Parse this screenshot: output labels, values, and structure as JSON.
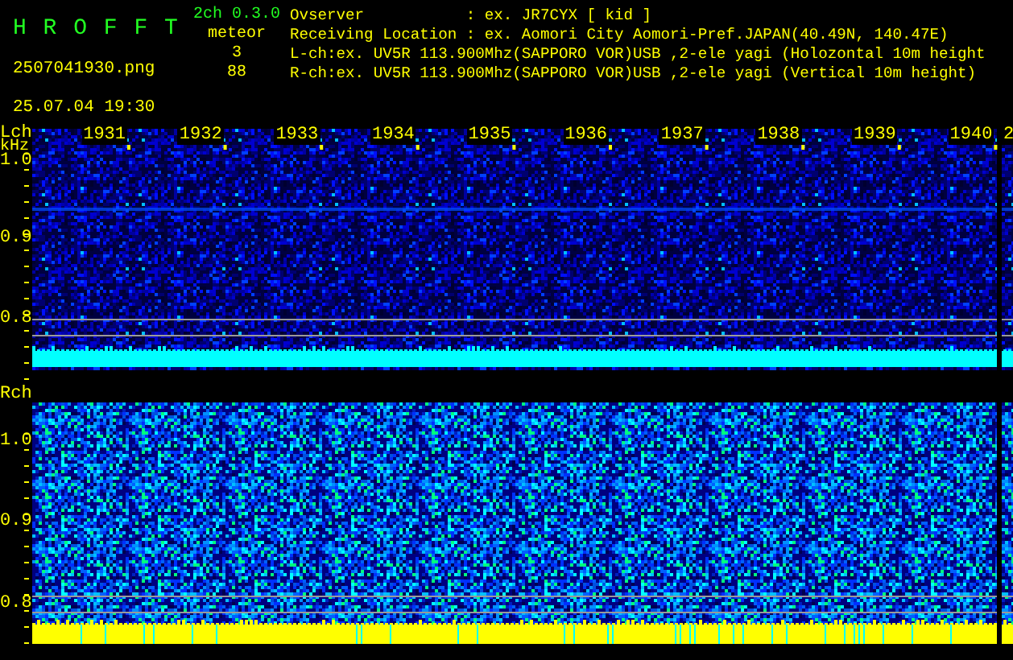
{
  "header": {
    "app_title": "H R O F F T",
    "version": "2ch 0.3.0",
    "file_name": "2507041930.png",
    "timestamp": "25.07.04 19:30",
    "meteor_label": "meteor",
    "meteor_counts": [
      "3",
      "88"
    ],
    "info_lines": [
      "Ovserver           : ex. JR7CYX [ kid ]",
      "Receiving Location : ex. Aomori City Aomori-Pref.JAPAN(40.49N, 140.47E)",
      "L-ch:ex. UV5R 113.900Mhz(SAPPORO VOR)USB ,2-ele yagi (Holozontal 10m height",
      "R-ch:ex. UV5R 113.900Mhz(SAPPORO VOR)USB ,2-ele yagi (Vertical 10m height)"
    ]
  },
  "time_axis": [
    "1931",
    "1932",
    "1933",
    "1934",
    "1935",
    "1936",
    "1937",
    "1938",
    "1939",
    "1940",
    "2"
  ],
  "channels": [
    {
      "label": "Lch",
      "unit": "kHz",
      "freq_labels": [
        "1.0",
        "0.9",
        "0.8"
      ]
    },
    {
      "label": "Rch",
      "freq_labels": [
        "1.0",
        "0.9",
        "0.8"
      ]
    }
  ]
}
